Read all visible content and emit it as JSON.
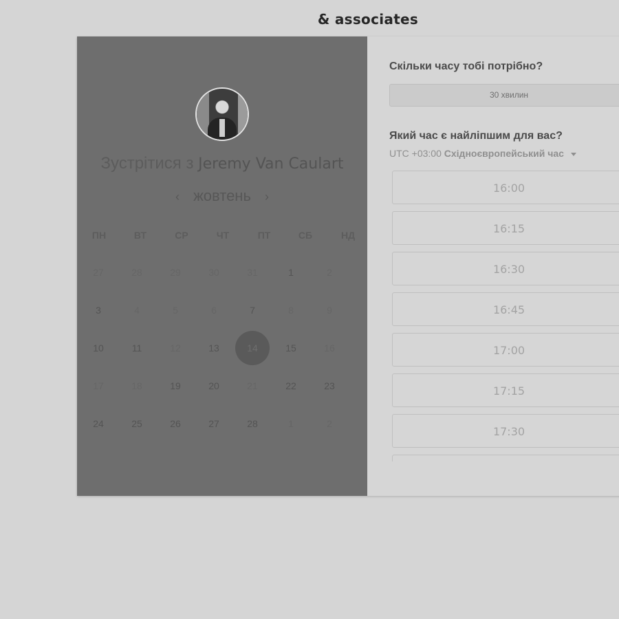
{
  "brand": {
    "name": "& associates"
  },
  "profile": {
    "meet_prefix": "Зустрітися з",
    "host_name": "Jeremy Van Caulart"
  },
  "calendar": {
    "month": "жовтень",
    "prev_label": "‹",
    "next_label": "›",
    "weekdays": [
      "ПН",
      "ВТ",
      "СР",
      "ЧТ",
      "ПТ",
      "СБ",
      "НД"
    ],
    "weeks": [
      [
        {
          "d": "27",
          "s": "dim"
        },
        {
          "d": "28",
          "s": "dim"
        },
        {
          "d": "29",
          "s": "dim"
        },
        {
          "d": "30",
          "s": "dim"
        },
        {
          "d": "31",
          "s": "dim"
        },
        {
          "d": "1",
          "s": "avail"
        },
        {
          "d": "2",
          "s": "dim"
        }
      ],
      [
        {
          "d": "3",
          "s": "avail"
        },
        {
          "d": "4",
          "s": "dim"
        },
        {
          "d": "5",
          "s": "dim"
        },
        {
          "d": "6",
          "s": "dim"
        },
        {
          "d": "7",
          "s": "avail"
        },
        {
          "d": "8",
          "s": "dim"
        },
        {
          "d": "9",
          "s": "dim"
        }
      ],
      [
        {
          "d": "10",
          "s": "avail"
        },
        {
          "d": "11",
          "s": "avail"
        },
        {
          "d": "12",
          "s": "dim"
        },
        {
          "d": "13",
          "s": "avail"
        },
        {
          "d": "14",
          "s": "selected"
        },
        {
          "d": "15",
          "s": "avail"
        },
        {
          "d": "16",
          "s": "dim"
        }
      ],
      [
        {
          "d": "17",
          "s": "dim"
        },
        {
          "d": "18",
          "s": "dim"
        },
        {
          "d": "19",
          "s": "avail"
        },
        {
          "d": "20",
          "s": "avail"
        },
        {
          "d": "21",
          "s": "dim"
        },
        {
          "d": "22",
          "s": "avail"
        },
        {
          "d": "23",
          "s": "avail"
        }
      ],
      [
        {
          "d": "24",
          "s": "avail"
        },
        {
          "d": "25",
          "s": "avail"
        },
        {
          "d": "26",
          "s": "avail"
        },
        {
          "d": "27",
          "s": "avail"
        },
        {
          "d": "28",
          "s": "avail"
        },
        {
          "d": "1",
          "s": "dim"
        },
        {
          "d": "2",
          "s": "dim"
        }
      ]
    ]
  },
  "booking": {
    "duration_question": "Скільки часу тобі потрібно?",
    "duration_value": "30 хвилин",
    "time_question": "Який час є найліпшим для вас?",
    "timezone_offset": "UTC +03:00",
    "timezone_name": "Східноєвропейський час",
    "slots": [
      "16:00",
      "16:15",
      "16:30",
      "16:45",
      "17:00",
      "17:15",
      "17:30",
      ""
    ]
  },
  "colors": {
    "page_bg": "#d5d5d5",
    "left_panel_bg": "#6e6e6e",
    "right_panel_bg": "#d6d6d6",
    "selected_day_bg": "#5a5a5a"
  }
}
